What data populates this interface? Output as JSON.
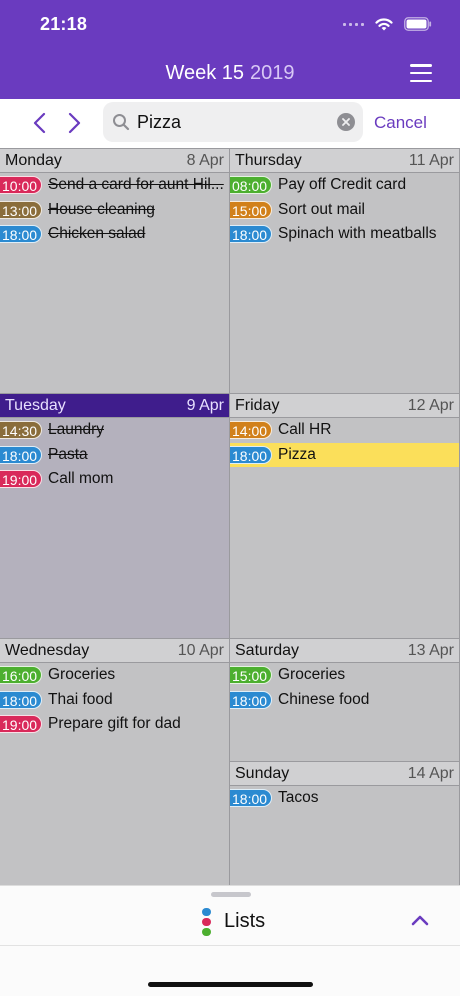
{
  "status_bar": {
    "time": "21:18"
  },
  "header": {
    "week_label": "Week 15",
    "year": "2019"
  },
  "search": {
    "query": "Pizza",
    "placeholder": "Search",
    "cancel_label": "Cancel"
  },
  "colors": {
    "red": "#d9295a",
    "brown": "#8a6d3b",
    "blue": "#2b8ad1",
    "green": "#4caf2f",
    "orange": "#d1801a",
    "highlight": "#fbdf5a",
    "accent": "#6a3bbf"
  },
  "days": [
    {
      "name": "Monday",
      "date": "8 Apr",
      "selected": false,
      "events": [
        {
          "time": "10:00",
          "text": "Send a card for aunt Hil...",
          "color": "#d9295a",
          "done": true
        },
        {
          "time": "13:00",
          "text": "House cleaning",
          "color": "#8a6d3b",
          "done": true
        },
        {
          "time": "18:00",
          "text": "Chicken salad",
          "color": "#2b8ad1",
          "done": true
        }
      ]
    },
    {
      "name": "Thursday",
      "date": "11 Apr",
      "selected": false,
      "events": [
        {
          "time": "08:00",
          "text": "Pay off Credit card",
          "color": "#4caf2f",
          "done": false
        },
        {
          "time": "15:00",
          "text": "Sort out mail",
          "color": "#d1801a",
          "done": false
        },
        {
          "time": "18:00",
          "text": "Spinach with meatballs",
          "color": "#2b8ad1",
          "done": false
        }
      ]
    },
    {
      "name": "Tuesday",
      "date": "9 Apr",
      "selected": true,
      "events": [
        {
          "time": "14:30",
          "text": "Laundry",
          "color": "#8a6d3b",
          "done": true
        },
        {
          "time": "18:00",
          "text": "Pasta",
          "color": "#2b8ad1",
          "done": true
        },
        {
          "time": "19:00",
          "text": "Call mom",
          "color": "#d9295a",
          "done": false
        }
      ]
    },
    {
      "name": "Friday",
      "date": "12 Apr",
      "selected": false,
      "events": [
        {
          "time": "14:00",
          "text": "Call HR",
          "color": "#d1801a",
          "done": false
        },
        {
          "time": "18:00",
          "text": "Pizza",
          "color": "#2b8ad1",
          "done": false,
          "highlight": true
        }
      ]
    },
    {
      "name": "Wednesday",
      "date": "10 Apr",
      "selected": false,
      "events": [
        {
          "time": "16:00",
          "text": "Groceries",
          "color": "#4caf2f",
          "done": false
        },
        {
          "time": "18:00",
          "text": "Thai food",
          "color": "#2b8ad1",
          "done": false
        },
        {
          "time": "19:00",
          "text": "Prepare gift for dad",
          "color": "#d9295a",
          "done": false
        }
      ]
    },
    {
      "name": "Saturday",
      "date": "13 Apr",
      "selected": false,
      "events": [
        {
          "time": "15:00",
          "text": "Groceries",
          "color": "#4caf2f",
          "done": false
        },
        {
          "time": "18:00",
          "text": "Chinese food",
          "color": "#2b8ad1",
          "done": false
        }
      ]
    },
    {
      "name": "Sunday",
      "date": "14 Apr",
      "selected": false,
      "events": [
        {
          "time": "18:00",
          "text": "Tacos",
          "color": "#2b8ad1",
          "done": false
        }
      ]
    }
  ],
  "bottom_sheet": {
    "lists_label": "Lists",
    "icon_colors": [
      "#2b8ad1",
      "#d9295a",
      "#4caf2f"
    ]
  }
}
